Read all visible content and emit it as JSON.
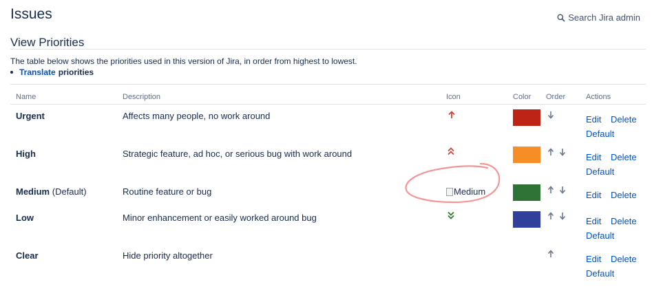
{
  "header": {
    "title": "Issues",
    "search_label": "Search Jira admin"
  },
  "section": {
    "title": "View Priorities",
    "intro": "The table below shows the priorities used in this version of Jira, in order from highest to lowest.",
    "bullet_link": "Translate",
    "bullet_text": "priorities"
  },
  "columns": {
    "name": "Name",
    "description": "Description",
    "icon": "Icon",
    "color": "Color",
    "order": "Order",
    "actions": "Actions"
  },
  "actions": {
    "edit": "Edit",
    "delete": "Delete",
    "default": "Default"
  },
  "rows": [
    {
      "name": "Urgent",
      "description": "Affects many people, no work around",
      "icon": "arrow-up-icon",
      "color": "#be2416",
      "order": [
        "down"
      ],
      "actions": [
        "Edit",
        "Delete",
        "Default"
      ]
    },
    {
      "name": "High",
      "description": "Strategic feature, ad hoc, or serious bug with work around",
      "icon": "double-chevron-up-icon",
      "color": "#f68d27",
      "order": [
        "up",
        "down"
      ],
      "actions": [
        "Edit",
        "Delete",
        "Default"
      ]
    },
    {
      "name": "Medium",
      "name_suffix": "(Default)",
      "description": "Routine feature or bug",
      "icon_alt": "Medium",
      "color": "#2e7335",
      "order": [
        "up",
        "down"
      ],
      "actions": [
        "Edit",
        "Delete"
      ]
    },
    {
      "name": "Low",
      "description": "Minor enhancement or easily worked around bug",
      "icon": "double-chevron-down-icon",
      "color": "#30409b",
      "order": [
        "up",
        "down"
      ],
      "actions": [
        "Edit",
        "Delete",
        "Default"
      ]
    },
    {
      "name": "Clear",
      "description": "Hide priority altogether",
      "icon": "",
      "color": "",
      "order": [
        "up"
      ],
      "actions": [
        "Edit",
        "Delete",
        "Default"
      ]
    }
  ],
  "colors": {
    "link": "#0052cc",
    "text": "#172b4d",
    "annotation": "#f28b8b"
  }
}
